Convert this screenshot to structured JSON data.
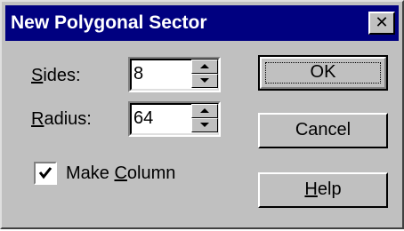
{
  "window": {
    "title": "New Polygonal Sector",
    "close_glyph": "✕"
  },
  "form": {
    "sides": {
      "label_hotkey": "S",
      "label_rest": "ides:",
      "value": "8"
    },
    "radius": {
      "label_hotkey": "R",
      "label_rest": "adius:",
      "value": "64"
    },
    "make_column": {
      "label_before": "Make ",
      "label_hotkey": "C",
      "label_after": "olumn",
      "checked": true
    }
  },
  "buttons": {
    "ok": "OK",
    "cancel": "Cancel",
    "help_hotkey": "H",
    "help_rest": "elp"
  },
  "colors": {
    "titlebar": "#000080",
    "face": "#c0c0c0"
  }
}
